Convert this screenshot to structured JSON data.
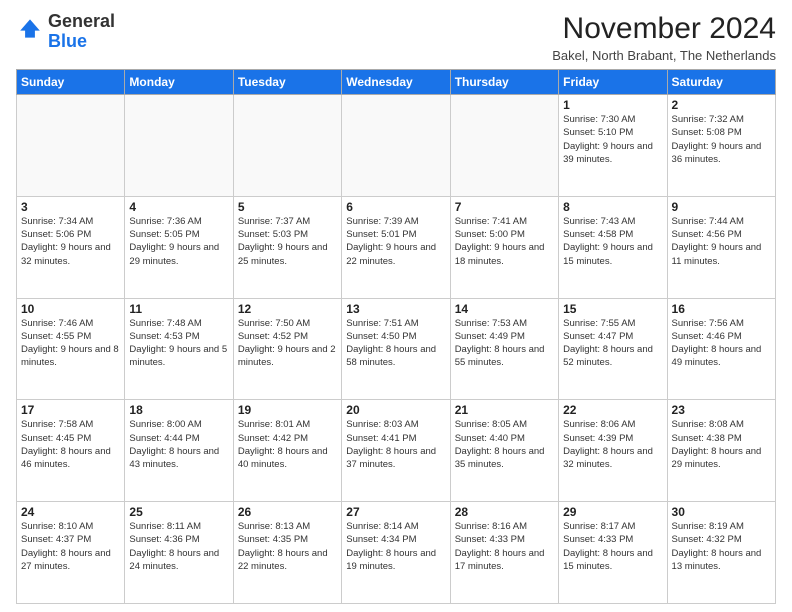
{
  "logo": {
    "general": "General",
    "blue": "Blue"
  },
  "title": "November 2024",
  "subtitle": "Bakel, North Brabant, The Netherlands",
  "days_header": [
    "Sunday",
    "Monday",
    "Tuesday",
    "Wednesday",
    "Thursday",
    "Friday",
    "Saturday"
  ],
  "weeks": [
    [
      {
        "day": "",
        "info": ""
      },
      {
        "day": "",
        "info": ""
      },
      {
        "day": "",
        "info": ""
      },
      {
        "day": "",
        "info": ""
      },
      {
        "day": "",
        "info": ""
      },
      {
        "day": "1",
        "info": "Sunrise: 7:30 AM\nSunset: 5:10 PM\nDaylight: 9 hours and 39 minutes."
      },
      {
        "day": "2",
        "info": "Sunrise: 7:32 AM\nSunset: 5:08 PM\nDaylight: 9 hours and 36 minutes."
      }
    ],
    [
      {
        "day": "3",
        "info": "Sunrise: 7:34 AM\nSunset: 5:06 PM\nDaylight: 9 hours and 32 minutes."
      },
      {
        "day": "4",
        "info": "Sunrise: 7:36 AM\nSunset: 5:05 PM\nDaylight: 9 hours and 29 minutes."
      },
      {
        "day": "5",
        "info": "Sunrise: 7:37 AM\nSunset: 5:03 PM\nDaylight: 9 hours and 25 minutes."
      },
      {
        "day": "6",
        "info": "Sunrise: 7:39 AM\nSunset: 5:01 PM\nDaylight: 9 hours and 22 minutes."
      },
      {
        "day": "7",
        "info": "Sunrise: 7:41 AM\nSunset: 5:00 PM\nDaylight: 9 hours and 18 minutes."
      },
      {
        "day": "8",
        "info": "Sunrise: 7:43 AM\nSunset: 4:58 PM\nDaylight: 9 hours and 15 minutes."
      },
      {
        "day": "9",
        "info": "Sunrise: 7:44 AM\nSunset: 4:56 PM\nDaylight: 9 hours and 11 minutes."
      }
    ],
    [
      {
        "day": "10",
        "info": "Sunrise: 7:46 AM\nSunset: 4:55 PM\nDaylight: 9 hours and 8 minutes."
      },
      {
        "day": "11",
        "info": "Sunrise: 7:48 AM\nSunset: 4:53 PM\nDaylight: 9 hours and 5 minutes."
      },
      {
        "day": "12",
        "info": "Sunrise: 7:50 AM\nSunset: 4:52 PM\nDaylight: 9 hours and 2 minutes."
      },
      {
        "day": "13",
        "info": "Sunrise: 7:51 AM\nSunset: 4:50 PM\nDaylight: 8 hours and 58 minutes."
      },
      {
        "day": "14",
        "info": "Sunrise: 7:53 AM\nSunset: 4:49 PM\nDaylight: 8 hours and 55 minutes."
      },
      {
        "day": "15",
        "info": "Sunrise: 7:55 AM\nSunset: 4:47 PM\nDaylight: 8 hours and 52 minutes."
      },
      {
        "day": "16",
        "info": "Sunrise: 7:56 AM\nSunset: 4:46 PM\nDaylight: 8 hours and 49 minutes."
      }
    ],
    [
      {
        "day": "17",
        "info": "Sunrise: 7:58 AM\nSunset: 4:45 PM\nDaylight: 8 hours and 46 minutes."
      },
      {
        "day": "18",
        "info": "Sunrise: 8:00 AM\nSunset: 4:44 PM\nDaylight: 8 hours and 43 minutes."
      },
      {
        "day": "19",
        "info": "Sunrise: 8:01 AM\nSunset: 4:42 PM\nDaylight: 8 hours and 40 minutes."
      },
      {
        "day": "20",
        "info": "Sunrise: 8:03 AM\nSunset: 4:41 PM\nDaylight: 8 hours and 37 minutes."
      },
      {
        "day": "21",
        "info": "Sunrise: 8:05 AM\nSunset: 4:40 PM\nDaylight: 8 hours and 35 minutes."
      },
      {
        "day": "22",
        "info": "Sunrise: 8:06 AM\nSunset: 4:39 PM\nDaylight: 8 hours and 32 minutes."
      },
      {
        "day": "23",
        "info": "Sunrise: 8:08 AM\nSunset: 4:38 PM\nDaylight: 8 hours and 29 minutes."
      }
    ],
    [
      {
        "day": "24",
        "info": "Sunrise: 8:10 AM\nSunset: 4:37 PM\nDaylight: 8 hours and 27 minutes."
      },
      {
        "day": "25",
        "info": "Sunrise: 8:11 AM\nSunset: 4:36 PM\nDaylight: 8 hours and 24 minutes."
      },
      {
        "day": "26",
        "info": "Sunrise: 8:13 AM\nSunset: 4:35 PM\nDaylight: 8 hours and 22 minutes."
      },
      {
        "day": "27",
        "info": "Sunrise: 8:14 AM\nSunset: 4:34 PM\nDaylight: 8 hours and 19 minutes."
      },
      {
        "day": "28",
        "info": "Sunrise: 8:16 AM\nSunset: 4:33 PM\nDaylight: 8 hours and 17 minutes."
      },
      {
        "day": "29",
        "info": "Sunrise: 8:17 AM\nSunset: 4:33 PM\nDaylight: 8 hours and 15 minutes."
      },
      {
        "day": "30",
        "info": "Sunrise: 8:19 AM\nSunset: 4:32 PM\nDaylight: 8 hours and 13 minutes."
      }
    ]
  ]
}
